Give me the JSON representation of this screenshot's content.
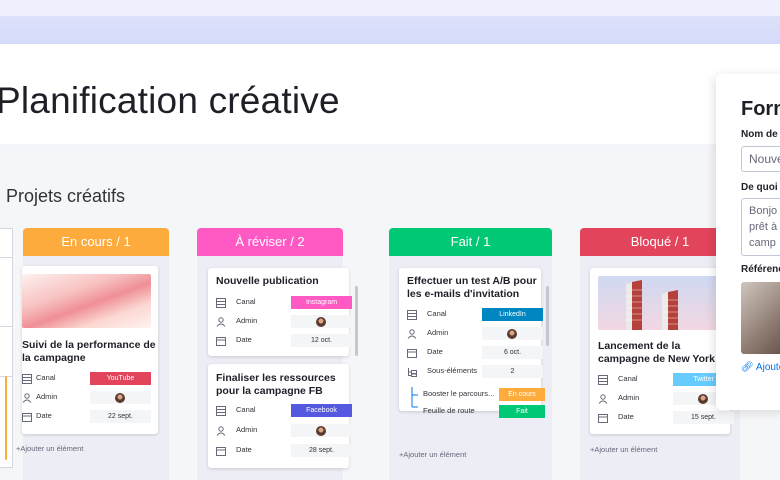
{
  "page_title": "Planification créative",
  "board_title": "Projets créatifs",
  "columns": [
    {
      "title": "En cours / 1",
      "color": "#fdab3d",
      "cards": [
        {
          "title_line1": "Suivi de la performance de",
          "title_line2": "la campagne",
          "fields": [
            {
              "label": "Canal",
              "value": "YouTube",
              "color": "#e2445c"
            },
            {
              "label": "Admin",
              "value": ""
            },
            {
              "label": "Date",
              "value": "22 sept."
            }
          ]
        }
      ],
      "add_label": "+Ajouter un élément"
    },
    {
      "title": "À réviser / 2",
      "color": "#ff5ac4",
      "cards": [
        {
          "title_line1": "Nouvelle publication",
          "fields": [
            {
              "label": "Canal",
              "value": "Instagram",
              "color": "#ff5ac4"
            },
            {
              "label": "Admin",
              "value": ""
            },
            {
              "label": "Date",
              "value": "12 oct."
            }
          ]
        },
        {
          "title_line1": "Finaliser les ressources",
          "title_line2": "pour la campagne FB",
          "fields": [
            {
              "label": "Canal",
              "value": "Facebook",
              "color": "#5559df"
            },
            {
              "label": "Admin",
              "value": ""
            },
            {
              "label": "Date",
              "value": "28 sept."
            }
          ]
        }
      ]
    },
    {
      "title": "Fait / 1",
      "color": "#00c875",
      "cards": [
        {
          "title_line1": "Effectuer un test A/B pour",
          "title_line2": "les e-mails d'invitation",
          "fields": [
            {
              "label": "Canal",
              "value": "LinkedIn",
              "color": "#0086c0"
            },
            {
              "label": "Admin",
              "value": ""
            },
            {
              "label": "Date",
              "value": "6 oct."
            },
            {
              "label": "Sous-éléments",
              "value": "2"
            }
          ],
          "subitems": [
            {
              "label": "Booster le parcours...",
              "status": "En cours",
              "color": "#fdab3d"
            },
            {
              "label": "Feuille de route",
              "status": "Fait",
              "color": "#00c875"
            }
          ]
        }
      ],
      "add_label": "+Ajouter un élément"
    },
    {
      "title": "Bloqué / 1",
      "color": "#e2445c",
      "cards": [
        {
          "title_line1": "Lancement de la",
          "title_line2": "campagne de New York",
          "fields": [
            {
              "label": "Canal",
              "value": "Twitter",
              "color": "#66ccff"
            },
            {
              "label": "Admin",
              "value": ""
            },
            {
              "label": "Date",
              "value": "15 sept."
            }
          ]
        }
      ],
      "add_label": "+Ajouter un élément"
    }
  ],
  "panel": {
    "title": "Form",
    "name_label": "Nom de",
    "name_value": "Nouve",
    "desc_label": "De quoi a",
    "desc_lines": [
      "Bonjo",
      "prêt à",
      "camp"
    ],
    "ref_label": "Référenc",
    "link_label": "Ajoute"
  }
}
